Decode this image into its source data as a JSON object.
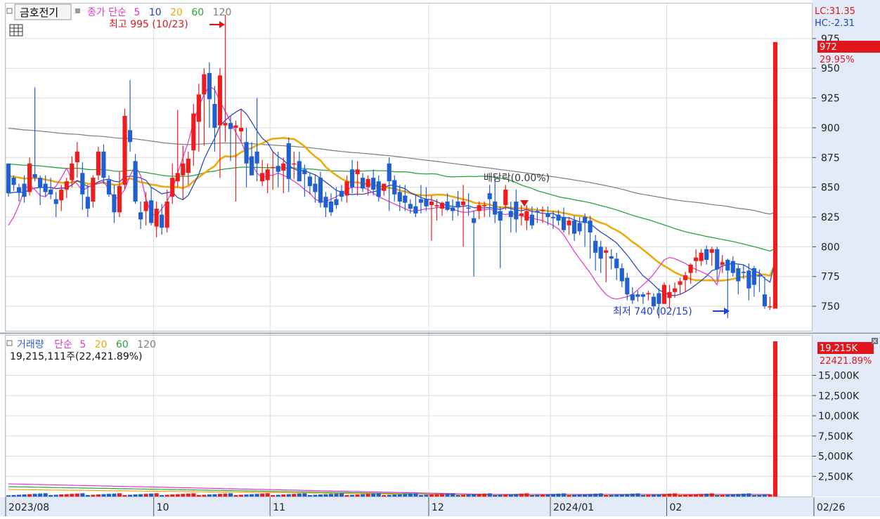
{
  "stock": {
    "name": "금호전기",
    "price_label": "종가 단순",
    "ma_periods": [
      "5",
      "10",
      "20",
      "60",
      "120"
    ]
  },
  "annotations": {
    "high": "최고 995 (10/23)",
    "low": "최저 740 (02/15)",
    "dividend": "배당락(0.00%)",
    "lc": "LC:31.35",
    "hc": "HC:-2.31",
    "current_price": "972",
    "change_pct": "29.95%"
  },
  "volume": {
    "title": "거래량",
    "ma_label": "단순",
    "ma_periods": [
      "5",
      "20",
      "60",
      "120"
    ],
    "summary": "19,215,111주(22,421.89%)",
    "current": "19,215K",
    "ratio": "22421.89%"
  },
  "colors": {
    "up": "#ee1c1c",
    "down": "#1f5fd0",
    "ma5": "#e233c8",
    "ma10": "#1b3fc7",
    "ma20": "#eea90d",
    "ma60": "#2aa43a",
    "ma120": "#7d7d7d",
    "grid": "#dcdcdc",
    "axis_bg": "#e2ebf7"
  },
  "chart_data": [
    {
      "type": "candlestick",
      "title": "금호전기",
      "x_ticks": [
        "2023/08",
        "10",
        "11",
        "12",
        "2024/01",
        "02",
        "02/26"
      ],
      "y_ticks": [
        750,
        775,
        800,
        825,
        850,
        875,
        900,
        925,
        950,
        975
      ],
      "ylim": [
        730,
        1005
      ],
      "grid": true,
      "candles": [
        [
          870,
          868,
          842,
          845
        ],
        [
          858,
          860,
          847,
          852
        ],
        [
          850,
          853,
          838,
          846
        ],
        [
          853,
          860,
          837,
          842
        ],
        [
          846,
          875,
          843,
          870
        ],
        [
          861,
          934,
          855,
          858
        ],
        [
          858,
          860,
          835,
          850
        ],
        [
          853,
          860,
          842,
          846
        ],
        [
          848,
          858,
          840,
          844
        ],
        [
          840,
          846,
          825,
          836
        ],
        [
          839,
          852,
          830,
          848
        ],
        [
          848,
          858,
          841,
          855
        ],
        [
          856,
          876,
          850,
          870
        ],
        [
          871,
          888,
          858,
          880
        ],
        [
          862,
          871,
          831,
          844
        ],
        [
          842,
          852,
          825,
          832
        ],
        [
          838,
          860,
          833,
          858
        ],
        [
          860,
          884,
          856,
          880
        ],
        [
          880,
          886,
          853,
          858
        ],
        [
          856,
          860,
          842,
          844
        ],
        [
          844,
          852,
          820,
          829
        ],
        [
          829,
          863,
          825,
          851
        ],
        [
          852,
          916,
          848,
          910
        ],
        [
          898,
          940,
          880,
          888
        ],
        [
          872,
          878,
          836,
          838
        ],
        [
          829,
          838,
          815,
          823
        ],
        [
          830,
          846,
          818,
          838
        ],
        [
          839,
          850,
          818,
          820
        ],
        [
          817,
          838,
          808,
          832
        ],
        [
          827,
          836,
          810,
          816
        ],
        [
          816,
          848,
          812,
          838
        ],
        [
          842,
          870,
          836,
          858
        ],
        [
          855,
          915,
          850,
          862
        ],
        [
          860,
          885,
          840,
          870
        ],
        [
          862,
          880,
          852,
          874
        ],
        [
          881,
          920,
          868,
          912
        ],
        [
          905,
          937,
          880,
          928
        ],
        [
          928,
          950,
          885,
          945
        ],
        [
          946,
          955,
          900,
          924
        ],
        [
          920,
          935,
          880,
          900
        ],
        [
          902,
          950,
          858,
          944
        ],
        [
          902,
          995,
          888,
          904
        ],
        [
          904,
          910,
          872,
          899
        ],
        [
          900,
          906,
          838,
          902
        ],
        [
          897,
          915,
          888,
          900
        ],
        [
          888,
          900,
          850,
          870
        ],
        [
          876,
          888,
          860,
          860
        ],
        [
          880,
          925,
          855,
          870
        ],
        [
          855,
          873,
          851,
          862
        ],
        [
          856,
          870,
          845,
          865
        ],
        [
          867,
          880,
          848,
          867
        ],
        [
          868,
          880,
          850,
          863
        ],
        [
          864,
          875,
          845,
          870
        ],
        [
          887,
          892,
          846,
          857
        ],
        [
          870,
          880,
          857,
          870
        ],
        [
          872,
          880,
          855,
          855
        ],
        [
          865,
          869,
          842,
          861
        ],
        [
          859,
          862,
          844,
          851
        ],
        [
          853,
          861,
          837,
          846
        ],
        [
          858,
          863,
          833,
          837
        ],
        [
          842,
          846,
          825,
          833
        ],
        [
          838,
          845,
          826,
          829
        ],
        [
          840,
          850,
          832,
          835
        ],
        [
          847,
          852,
          838,
          842
        ],
        [
          843,
          860,
          837,
          855
        ],
        [
          865,
          873,
          845,
          850
        ],
        [
          861,
          872,
          843,
          865
        ],
        [
          858,
          862,
          846,
          849
        ],
        [
          850,
          860,
          843,
          857
        ],
        [
          858,
          865,
          843,
          848
        ],
        [
          855,
          860,
          838,
          842
        ],
        [
          847,
          853,
          843,
          853
        ],
        [
          870,
          875,
          830,
          855
        ],
        [
          856,
          860,
          838,
          844
        ],
        [
          846,
          852,
          830,
          838
        ],
        [
          843,
          852,
          830,
          837
        ],
        [
          836,
          840,
          828,
          832
        ],
        [
          834,
          843,
          825,
          828
        ],
        [
          840,
          852,
          828,
          837
        ],
        [
          840,
          850,
          830,
          834
        ],
        [
          835,
          843,
          805,
          838
        ],
        [
          834,
          840,
          822,
          835
        ],
        [
          832,
          838,
          826,
          837
        ],
        [
          838,
          845,
          830,
          831
        ],
        [
          833,
          840,
          822,
          830
        ],
        [
          838,
          847,
          826,
          833
        ],
        [
          835,
          852,
          800,
          838
        ],
        [
          833,
          845,
          826,
          832
        ],
        [
          824,
          830,
          775,
          820
        ],
        [
          830,
          838,
          823,
          835
        ],
        [
          834,
          838,
          825,
          835
        ],
        [
          845,
          852,
          825,
          840
        ],
        [
          838,
          860,
          820,
          827
        ],
        [
          830,
          834,
          782,
          822
        ],
        [
          835,
          852,
          831,
          848
        ],
        [
          830,
          838,
          812,
          825
        ],
        [
          838,
          848,
          812,
          823
        ],
        [
          826,
          835,
          818,
          828
        ],
        [
          822,
          835,
          814,
          830
        ],
        [
          827,
          834,
          815,
          818
        ],
        [
          830,
          833,
          820,
          829
        ],
        [
          830,
          834,
          820,
          831
        ],
        [
          828,
          834,
          818,
          825
        ],
        [
          825,
          830,
          815,
          824
        ],
        [
          827,
          831,
          818,
          822
        ],
        [
          825,
          833,
          812,
          814
        ],
        [
          818,
          825,
          810,
          822
        ],
        [
          822,
          826,
          805,
          811
        ],
        [
          820,
          825,
          810,
          813
        ],
        [
          825,
          828,
          800,
          820
        ],
        [
          822,
          826,
          790,
          812
        ],
        [
          805,
          810,
          780,
          795
        ],
        [
          800,
          805,
          778,
          790
        ],
        [
          795,
          800,
          770,
          797
        ],
        [
          792,
          798,
          781,
          790
        ],
        [
          790,
          795,
          772,
          782
        ],
        [
          782,
          786,
          766,
          771
        ],
        [
          774,
          778,
          755,
          760
        ],
        [
          760,
          766,
          752,
          755
        ],
        [
          760,
          763,
          754,
          758
        ],
        [
          760,
          762,
          752,
          758
        ],
        [
          760,
          763,
          755,
          761
        ],
        [
          758,
          761,
          747,
          750
        ],
        [
          761,
          765,
          740,
          752
        ],
        [
          752,
          770,
          752,
          768
        ],
        [
          757,
          768,
          748,
          762
        ],
        [
          762,
          770,
          757,
          765
        ],
        [
          768,
          774,
          760,
          771
        ],
        [
          772,
          779,
          762,
          776
        ],
        [
          778,
          786,
          769,
          785
        ],
        [
          788,
          798,
          778,
          791
        ],
        [
          788,
          798,
          784,
          795
        ],
        [
          798,
          801,
          785,
          789
        ],
        [
          795,
          800,
          784,
          798
        ],
        [
          798,
          800,
          772,
          781
        ],
        [
          785,
          793,
          778,
          787
        ],
        [
          789,
          790,
          740,
          780
        ],
        [
          788,
          792,
          775,
          778
        ],
        [
          782,
          785,
          760,
          771
        ],
        [
          779,
          785,
          773,
          778
        ],
        [
          780,
          786,
          755,
          765
        ],
        [
          782,
          784,
          758,
          768
        ],
        [
          776,
          781,
          762,
          775
        ],
        [
          760,
          775,
          748,
          750
        ],
        [
          750,
          758,
          747,
          750
        ],
        [
          748,
          972,
          748,
          972
        ]
      ],
      "ma5_start": [
        818,
        825,
        835,
        848,
        852,
        848,
        843,
        842,
        847,
        851,
        858,
        866,
        856,
        853,
        847,
        850,
        852,
        853,
        855,
        848,
        840,
        842,
        848,
        860,
        868,
        860,
        840,
        828,
        826,
        832,
        838,
        848,
        862,
        875,
        888,
        905,
        918,
        928,
        935,
        932,
        922,
        914,
        905,
        896,
        888,
        878,
        870,
        862,
        858,
        860,
        860,
        862,
        860,
        858,
        855,
        852,
        848,
        845,
        840,
        838,
        838,
        840,
        842,
        845,
        848,
        850,
        850,
        850,
        848,
        845,
        842,
        840,
        838,
        836,
        834,
        832,
        830,
        830,
        831,
        832,
        832,
        833,
        833,
        833,
        832,
        830,
        829,
        829,
        830,
        831,
        831,
        832,
        830,
        828,
        827,
        828,
        827,
        826,
        825,
        824,
        823,
        822,
        820,
        818,
        815,
        810,
        803,
        796,
        790,
        784,
        778,
        771,
        765,
        760,
        757,
        756,
        757,
        758,
        760,
        764,
        768,
        772,
        777,
        783,
        789,
        791,
        790,
        788,
        786,
        783,
        781,
        779,
        777,
        774,
        768,
        790
      ]
    },
    {
      "type": "bar",
      "title": "거래량",
      "y_ticks": [
        "2,500K",
        "5,000K",
        "7,500K",
        "10,000K",
        "12,500K",
        "15,000K"
      ],
      "ylim": [
        0,
        20000
      ],
      "current_volume": 19215,
      "unit": "K"
    }
  ]
}
